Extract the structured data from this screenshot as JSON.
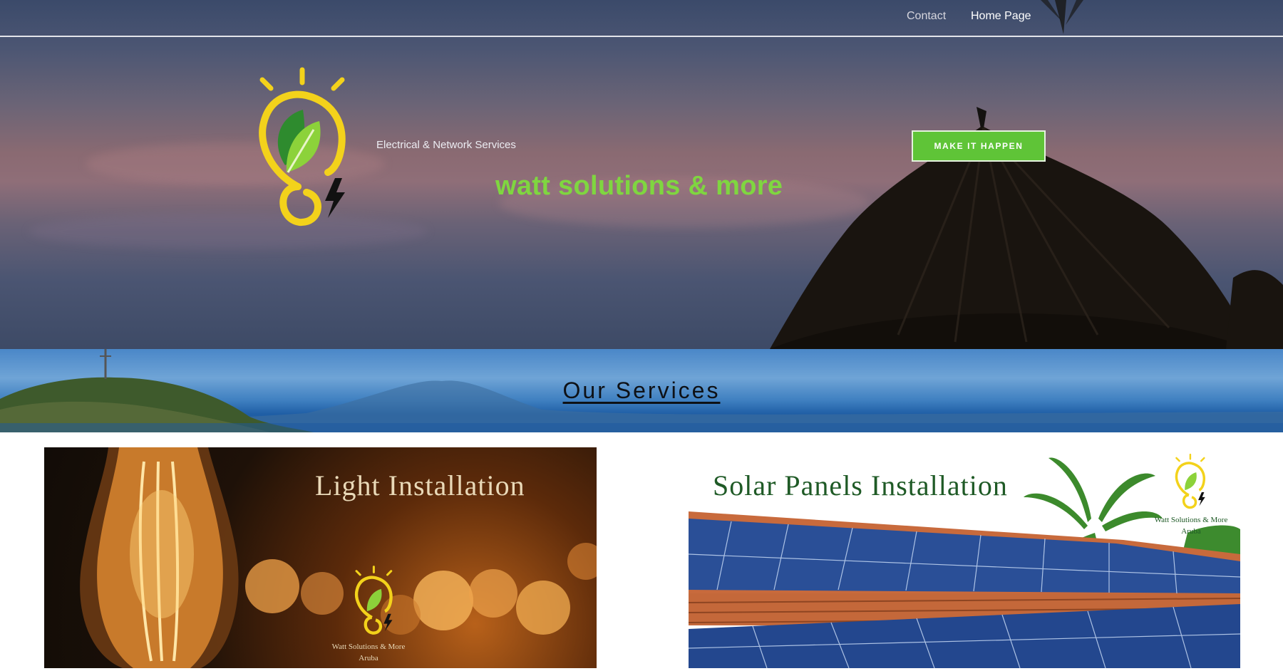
{
  "nav": {
    "contact": "Contact",
    "home": "Home Page"
  },
  "hero": {
    "tagline": "Electrical & Network Services",
    "brand": "watt solutions & more",
    "cta": "MAKE IT HAPPEN"
  },
  "services": {
    "heading": "Our Services",
    "cards": [
      {
        "title": "Light Installation",
        "caption_line1": "Watt Solutions & More",
        "caption_line2": "Aruba"
      },
      {
        "title": "Solar Panels Installation",
        "caption_line1": "Watt Solutions & More",
        "caption_line2": "Aruba"
      }
    ]
  },
  "colors": {
    "brand_green": "#7fd640",
    "cta_green": "#5fc437",
    "logo_yellow": "#f3d21b",
    "leaf_green": "#2e8b2e"
  },
  "icons": {
    "logo": "bulb-leaf-logo-icon",
    "bolt": "lightning-bolt-icon"
  }
}
